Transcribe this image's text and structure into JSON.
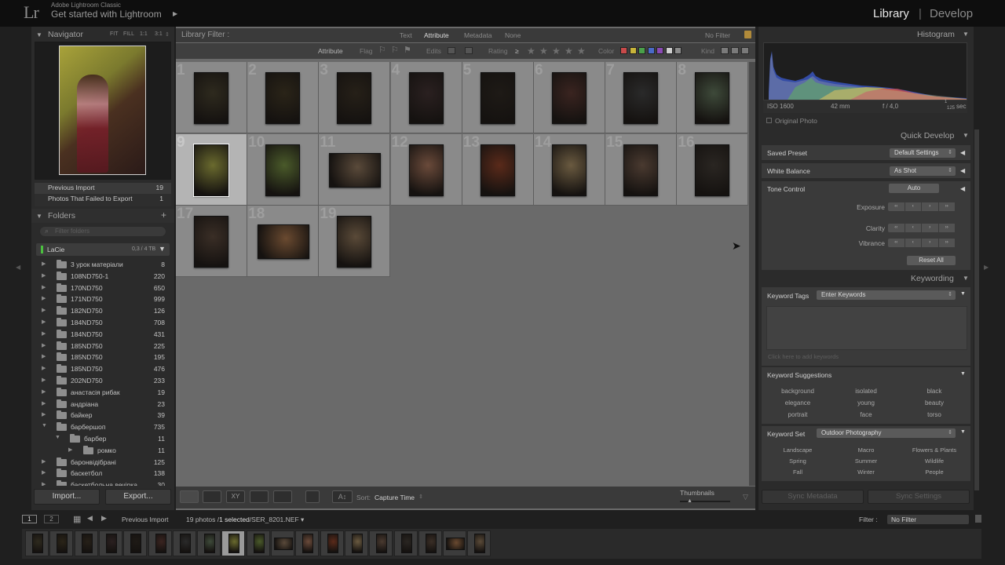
{
  "app": {
    "subtitle": "Adobe Lightroom Classic",
    "catalog": "Get started with Lightroom",
    "logo": "Lr"
  },
  "modules": {
    "library": "Library",
    "separator": "|",
    "develop": "Develop"
  },
  "navigator": {
    "title": "Navigator",
    "options": [
      "FIT",
      "FILL",
      "1:1",
      "3:1"
    ]
  },
  "collections": [
    {
      "label": "Previous Import",
      "count": "19"
    },
    {
      "label": "Photos That Failed to Export",
      "count": "1"
    }
  ],
  "folders": {
    "title": "Folders",
    "filter_placeholder": "Filter folders",
    "volume": {
      "name": "LaCie",
      "size": "0,3 / 4 TB"
    },
    "items": [
      {
        "name": "3 урок матеріали",
        "count": "8",
        "level": 0,
        "expanded": false
      },
      {
        "name": "108ND750-1",
        "count": "220",
        "level": 0,
        "expanded": false
      },
      {
        "name": "170ND750",
        "count": "650",
        "level": 0,
        "expanded": false
      },
      {
        "name": "171ND750",
        "count": "999",
        "level": 0,
        "expanded": false
      },
      {
        "name": "182ND750",
        "count": "126",
        "level": 0,
        "expanded": false
      },
      {
        "name": "184ND750",
        "count": "708",
        "level": 0,
        "expanded": false
      },
      {
        "name": "184ND750",
        "count": "431",
        "level": 0,
        "expanded": false
      },
      {
        "name": "185ND750",
        "count": "225",
        "level": 0,
        "expanded": false
      },
      {
        "name": "185ND750",
        "count": "195",
        "level": 0,
        "expanded": false
      },
      {
        "name": "185ND750",
        "count": "476",
        "level": 0,
        "expanded": false
      },
      {
        "name": "202ND750",
        "count": "233",
        "level": 0,
        "expanded": false
      },
      {
        "name": "анастасія рибак",
        "count": "19",
        "level": 0,
        "expanded": false
      },
      {
        "name": "андріана",
        "count": "23",
        "level": 0,
        "expanded": false
      },
      {
        "name": "байкер",
        "count": "39",
        "level": 0,
        "expanded": false
      },
      {
        "name": "барбершоп",
        "count": "735",
        "level": 0,
        "expanded": true
      },
      {
        "name": "барбер",
        "count": "11",
        "level": 1,
        "expanded": true
      },
      {
        "name": "ромко",
        "count": "11",
        "level": 2,
        "expanded": false
      },
      {
        "name": "баронвідібрані",
        "count": "125",
        "level": 0,
        "expanded": false
      },
      {
        "name": "баскетбол",
        "count": "138",
        "level": 0,
        "expanded": false
      },
      {
        "name": "баскетбольна вечірка",
        "count": "30",
        "level": 0,
        "expanded": false
      }
    ]
  },
  "left_buttons": {
    "import": "Import...",
    "export": "Export..."
  },
  "library_filter": {
    "title": "Library Filter :",
    "tabs": [
      "Text",
      "Attribute",
      "Metadata",
      "None"
    ],
    "active_tab": "Attribute",
    "preset": "No Filter"
  },
  "attribute_bar": {
    "label": "Attribute",
    "flag": "Flag",
    "edits": "Edits",
    "rating": "Rating",
    "rating_op": "≥",
    "color": "Color",
    "kind": "Kind",
    "color_swatches": [
      "#c84a4a",
      "#c8b43a",
      "#4aa04a",
      "#4a6ac8",
      "#8a4ab4",
      "#cfcfcf",
      "#8a8a8a"
    ]
  },
  "grid": {
    "selected_index": 9,
    "cells": [
      {
        "n": "1",
        "orient": "p",
        "tone": "#2e2a1e"
      },
      {
        "n": "2",
        "orient": "p",
        "tone": "#2a2418"
      },
      {
        "n": "3",
        "orient": "p",
        "tone": "#262018"
      },
      {
        "n": "4",
        "orient": "p",
        "tone": "#2a2020"
      },
      {
        "n": "5",
        "orient": "p",
        "tone": "#1e1a16"
      },
      {
        "n": "6",
        "orient": "p",
        "tone": "#3a2420"
      },
      {
        "n": "7",
        "orient": "p",
        "tone": "#2a2a2a"
      },
      {
        "n": "8",
        "orient": "p",
        "tone": "#3e4a3a"
      },
      {
        "n": "9",
        "orient": "p",
        "tone": "#6a6a2e"
      },
      {
        "n": "10",
        "orient": "p",
        "tone": "#4a5a2a"
      },
      {
        "n": "11",
        "orient": "l",
        "tone": "#5a4a3a"
      },
      {
        "n": "12",
        "orient": "p",
        "tone": "#6a4a3a"
      },
      {
        "n": "13",
        "orient": "p",
        "tone": "#5a2a1a"
      },
      {
        "n": "14",
        "orient": "p",
        "tone": "#6a5a40"
      },
      {
        "n": "15",
        "orient": "p",
        "tone": "#4a3a30"
      },
      {
        "n": "16",
        "orient": "p",
        "tone": "#2a2622"
      },
      {
        "n": "17",
        "orient": "p",
        "tone": "#3a2e26"
      },
      {
        "n": "18",
        "orient": "l",
        "tone": "#6a4a30"
      },
      {
        "n": "19",
        "orient": "p",
        "tone": "#5a4a38"
      }
    ]
  },
  "toolbar": {
    "sort_label": "Sort:",
    "sort_value": "Capture Time",
    "thumbnails": "Thumbnails"
  },
  "histogram": {
    "title": "Histogram",
    "iso": "ISO 1600",
    "focal": "42 mm",
    "aperture": "f / 4,0",
    "shutter_num": "1",
    "shutter_den": "125",
    "shutter_unit": "sec",
    "original_photo": "Original Photo"
  },
  "quick_develop": {
    "title": "Quick Develop",
    "saved_preset_label": "Saved Preset",
    "saved_preset_value": "Default Settings",
    "white_balance_label": "White Balance",
    "white_balance_value": "As Shot",
    "tone_control_label": "Tone Control",
    "auto": "Auto",
    "exposure": "Exposure",
    "clarity": "Clarity",
    "vibrance": "Vibrance",
    "reset_all": "Reset All"
  },
  "keywording": {
    "title": "Keywording",
    "tags_label": "Keyword Tags",
    "tags_value": "Enter Keywords",
    "hint": "Click here to add keywords",
    "suggestions_title": "Keyword Suggestions",
    "suggestions": [
      "background",
      "isolated",
      "black",
      "elegance",
      "young",
      "beauty",
      "portrait",
      "face",
      "torso"
    ],
    "set_label": "Keyword Set",
    "set_value": "Outdoor Photography",
    "set_items": [
      "Landscape",
      "Macro",
      "Flowers & Plants",
      "Spring",
      "Summer",
      "Wildlife",
      "Fall",
      "Winter",
      "People"
    ]
  },
  "sync": {
    "metadata": "Sync Metadata",
    "settings": "Sync Settings"
  },
  "filmstrip": {
    "screen1": "1",
    "screen2": "2",
    "source": "Previous Import",
    "count_prefix": "19 photos /",
    "count_selected": "1 selected",
    "filename": "/SER_8201.NEF",
    "filter_label": "Filter :",
    "filter_value": "No Filter"
  }
}
